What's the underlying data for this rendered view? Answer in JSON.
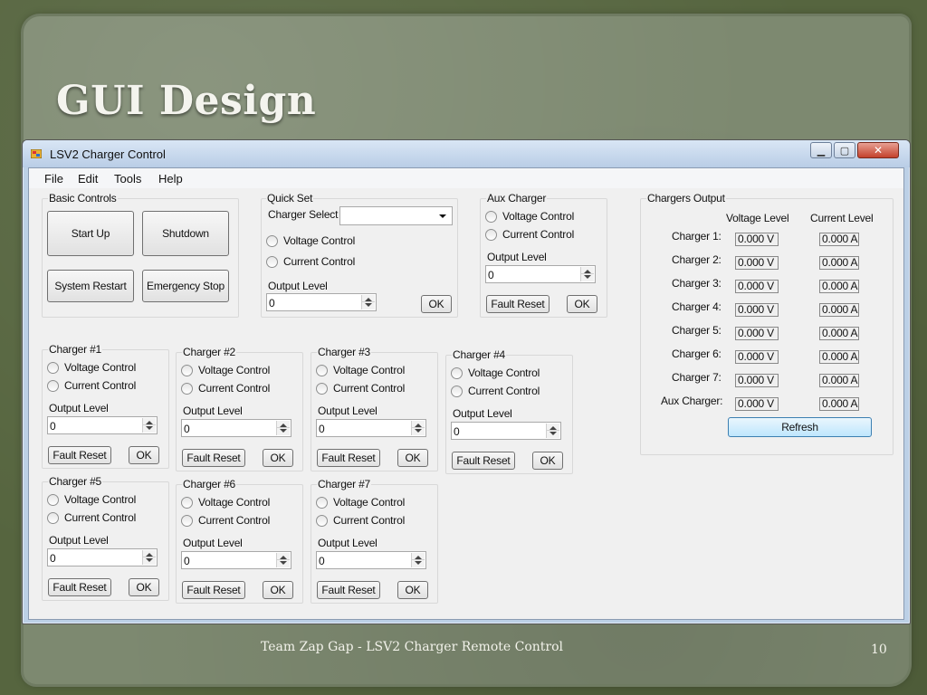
{
  "slide": {
    "title": "GUI Design",
    "footer": "Team Zap Gap - LSV2 Charger Remote Control",
    "page_number": "10"
  },
  "window": {
    "title": "LSV2 Charger Control",
    "app_icon": "window-app-icon",
    "controls": {
      "minimize": "▁",
      "maximize": "▢",
      "close": "✕"
    }
  },
  "menu": [
    "File",
    "Edit",
    "Tools",
    "Help"
  ],
  "basic_controls": {
    "label": "Basic Controls",
    "start_up": "Start Up",
    "shutdown": "Shutdown",
    "system_restart": "System Restart",
    "emergency_stop": "Emergency Stop"
  },
  "quick_set": {
    "label": "Quick Set",
    "charger_select_label": "Charger Select",
    "charger_select_value": "",
    "voltage_control": "Voltage Control",
    "current_control": "Current Control",
    "output_level_label": "Output Level",
    "output_level_value": "0",
    "ok": "OK"
  },
  "aux_charger": {
    "label": "Aux Charger",
    "voltage_control": "Voltage Control",
    "current_control": "Current Control",
    "output_level_label": "Output Level",
    "output_level_value": "0",
    "fault_reset": "Fault Reset",
    "ok": "OK"
  },
  "chargers": [
    {
      "label": "Charger #1",
      "voltage_control": "Voltage Control",
      "current_control": "Current Control",
      "output_level_label": "Output Level",
      "output_level_value": "0",
      "fault_reset": "Fault Reset",
      "ok": "OK"
    },
    {
      "label": "Charger #2",
      "voltage_control": "Voltage Control",
      "current_control": "Current Control",
      "output_level_label": "Output Level",
      "output_level_value": "0",
      "fault_reset": "Fault Reset",
      "ok": "OK"
    },
    {
      "label": "Charger #3",
      "voltage_control": "Voltage Control",
      "current_control": "Current Control",
      "output_level_label": "Output Level",
      "output_level_value": "0",
      "fault_reset": "Fault Reset",
      "ok": "OK"
    },
    {
      "label": "Charger #4",
      "voltage_control": "Voltage Control",
      "current_control": "Current Control",
      "output_level_label": "Output Level",
      "output_level_value": "0",
      "fault_reset": "Fault Reset",
      "ok": "OK"
    },
    {
      "label": "Charger #5",
      "voltage_control": "Voltage Control",
      "current_control": "Current Control",
      "output_level_label": "Output Level",
      "output_level_value": "0",
      "fault_reset": "Fault Reset",
      "ok": "OK"
    },
    {
      "label": "Charger #6",
      "voltage_control": "Voltage Control",
      "current_control": "Current Control",
      "output_level_label": "Output Level",
      "output_level_value": "0",
      "fault_reset": "Fault Reset",
      "ok": "OK"
    },
    {
      "label": "Charger #7",
      "voltage_control": "Voltage Control",
      "current_control": "Current Control",
      "output_level_label": "Output Level",
      "output_level_value": "0",
      "fault_reset": "Fault Reset",
      "ok": "OK"
    }
  ],
  "chargers_output": {
    "label": "Chargers Output",
    "voltage_header": "Voltage Level",
    "current_header": "Current Level",
    "rows": [
      {
        "name": "Charger 1:",
        "voltage": "0.000 V",
        "current": "0.000 A"
      },
      {
        "name": "Charger 2:",
        "voltage": "0.000 V",
        "current": "0.000 A"
      },
      {
        "name": "Charger 3:",
        "voltage": "0.000 V",
        "current": "0.000 A"
      },
      {
        "name": "Charger 4:",
        "voltage": "0.000 V",
        "current": "0.000 A"
      },
      {
        "name": "Charger 5:",
        "voltage": "0.000 V",
        "current": "0.000 A"
      },
      {
        "name": "Charger 6:",
        "voltage": "0.000 V",
        "current": "0.000 A"
      },
      {
        "name": "Charger 7:",
        "voltage": "0.000 V",
        "current": "0.000 A"
      },
      {
        "name": "Aux Charger:",
        "voltage": "0.000 V",
        "current": "0.000 A"
      }
    ],
    "refresh": "Refresh"
  },
  "colors": {
    "slide_green": "#56653f",
    "paper_green": "#7d8970",
    "window_frame": "#bcd0e6",
    "client_bg": "#f0f0f0",
    "close_red": "#c3412c",
    "refresh_blue": "#bee6fd"
  }
}
